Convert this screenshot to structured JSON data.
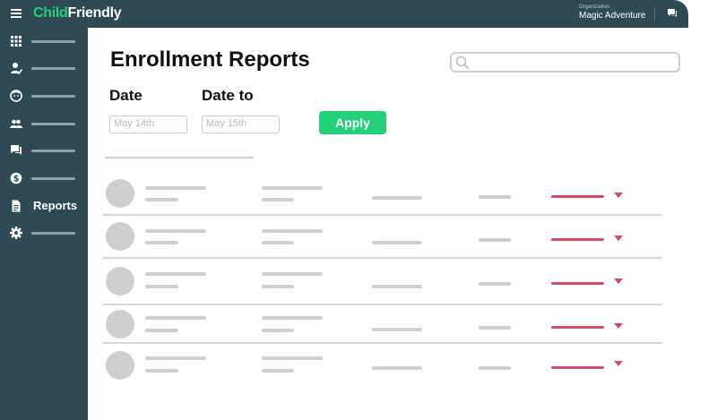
{
  "app": {
    "logo_part1": "Child",
    "logo_part2": "Friendly",
    "organization_label": "Organization",
    "organization_name": "Magic Adventure"
  },
  "sidebar": {
    "items": [
      {
        "icon": "grid-icon",
        "label": ""
      },
      {
        "icon": "user-check-icon",
        "label": ""
      },
      {
        "icon": "child-face-icon",
        "label": ""
      },
      {
        "icon": "people-icon",
        "label": ""
      },
      {
        "icon": "chat-icon",
        "label": ""
      },
      {
        "icon": "dollar-icon",
        "label": ""
      },
      {
        "icon": "document-icon",
        "label": "Reports"
      },
      {
        "icon": "gear-icon",
        "label": ""
      }
    ],
    "active_item": "Reports"
  },
  "main": {
    "title": "Enrollment Reports",
    "search": {
      "placeholder": ""
    },
    "date_label": "Date",
    "date_to_label": "Date to",
    "date_value": "May 14th",
    "date_to_value": "May 15th",
    "apply_label": "Apply"
  },
  "table": {
    "row_count": 5,
    "status_color": "#d8486a"
  },
  "colors": {
    "brand_dark": "#2f4a52",
    "accent_green": "#22d07a"
  }
}
